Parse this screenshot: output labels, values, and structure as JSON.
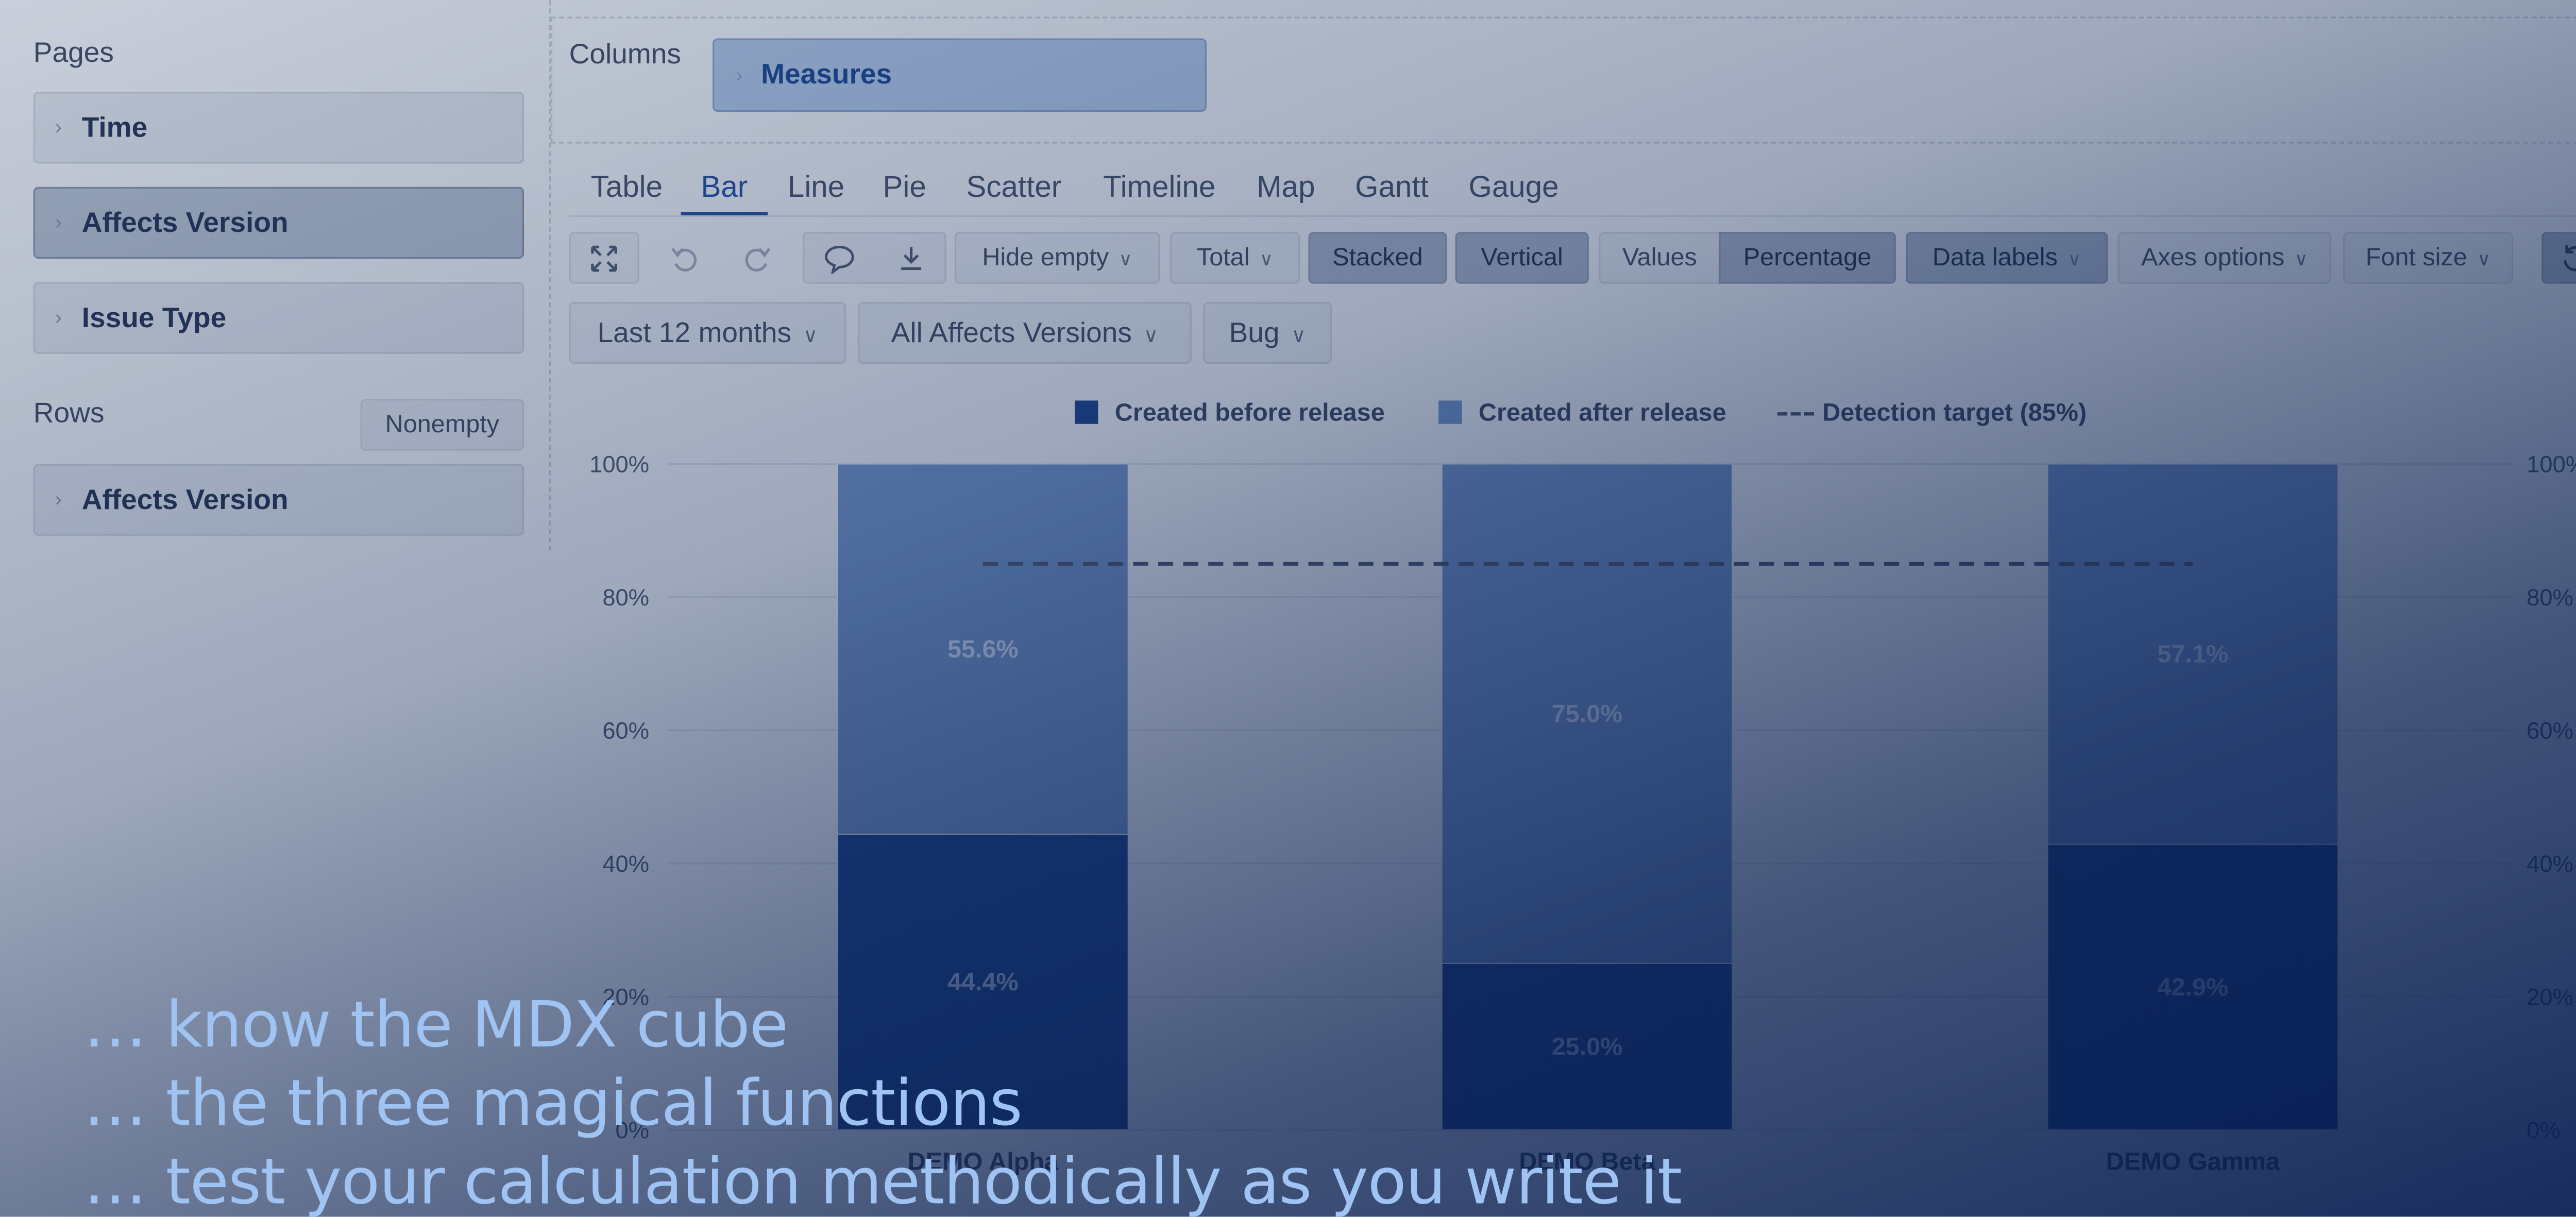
{
  "left_panel": {
    "pages_title": "Pages",
    "pages": [
      {
        "label": "Time"
      },
      {
        "label": "Affects Version"
      },
      {
        "label": "Issue Type"
      }
    ],
    "rows_title": "Rows",
    "nonempty_label": "Nonempty",
    "rows": [
      {
        "label": "Affects Version"
      }
    ]
  },
  "columns": {
    "title": "Columns",
    "measures_label": "Measures"
  },
  "tabs": [
    "Table",
    "Bar",
    "Line",
    "Pie",
    "Scatter",
    "Timeline",
    "Map",
    "Gantt",
    "Gauge"
  ],
  "active_tab": "Bar",
  "toolbar": {
    "hide_empty": "Hide empty",
    "total": "Total",
    "stacked": "Stacked",
    "vertical": "Vertical",
    "values": "Values",
    "percentage": "Percentage",
    "data_labels": "Data labels",
    "axes_options": "Axes options",
    "font_size": "Font size",
    "icons": [
      "expand-icon",
      "undo-icon",
      "redo-icon",
      "comment-icon",
      "download-icon",
      "refresh-icon"
    ]
  },
  "filters": {
    "time": "Last 12 months",
    "versions": "All Affects Versions",
    "issue_type": "Bug"
  },
  "chart_data": {
    "type": "bar",
    "stacked": true,
    "orientation": "vertical",
    "categories": [
      "DEMO Alpha",
      "DEMO Beta",
      "DEMO Gamma"
    ],
    "series": [
      {
        "name": "Created before release",
        "values": [
          44.4,
          25.0,
          42.9
        ],
        "labels": [
          "44.4%",
          "25.0%",
          "42.9%"
        ],
        "color": "#1e4389"
      },
      {
        "name": "Created after release",
        "values": [
          55.6,
          75.0,
          57.1
        ],
        "labels": [
          "55.6%",
          "75.0%",
          "57.1%"
        ],
        "color": "#6d8fc3"
      }
    ],
    "target_line": {
      "name": "Detection target (85%)",
      "value": 85,
      "color": "#4a5670"
    },
    "y_ticks": [
      "0%",
      "20%",
      "40%",
      "60%",
      "80%",
      "100%"
    ],
    "ylim": [
      0,
      100
    ],
    "legend_position": "top-center",
    "grid": true
  },
  "captions": [
    "… know the MDX cube",
    "… the three magical functions",
    "… test your calculation methodically as you write it"
  ],
  "colors": {
    "accent": "#244f9c",
    "overlay": "#0a1e50",
    "caption": "#9fc3f2"
  }
}
